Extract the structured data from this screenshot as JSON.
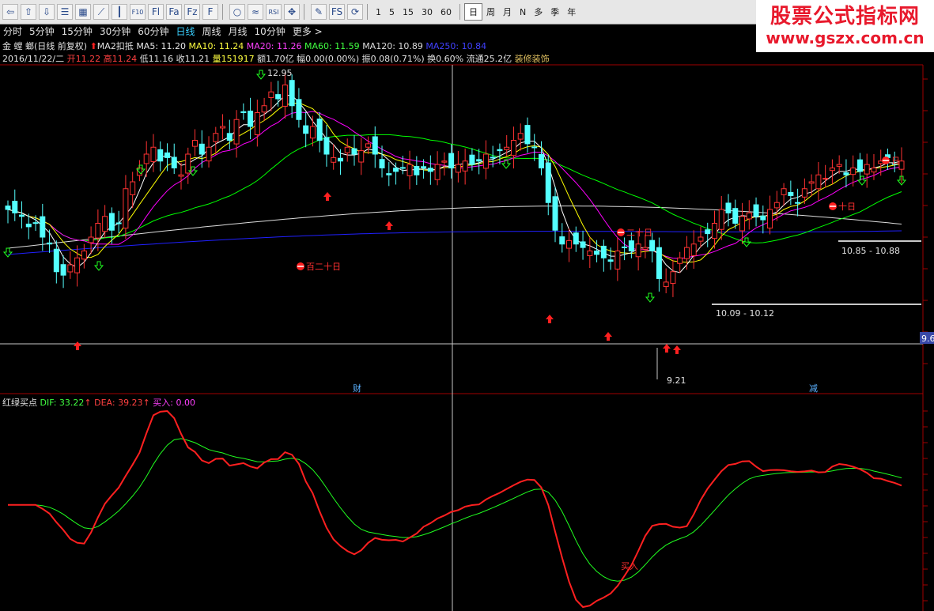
{
  "toolbar": {
    "icons": [
      "back-icon",
      "up-icon",
      "down-icon",
      "list-icon",
      "table-icon",
      "line-chart-icon",
      "candle-icon",
      "f10-icon",
      "fl-icon",
      "fa-icon",
      "fz-icon",
      "f-icon",
      "circle-icon",
      "wave-icon",
      "rsi-icon",
      "move-icon",
      "pencil-icon",
      "fs-icon",
      "refresh-icon"
    ],
    "icon_text": [
      "⇦",
      "⇧",
      "⇩",
      "☰",
      "▦",
      "⟋",
      "┃",
      "F10",
      "Fl",
      "Fa",
      "Fz",
      "F",
      "○",
      "≈",
      "RSI",
      "✥",
      "✎",
      "FS",
      "⟳"
    ],
    "intervals": [
      "1",
      "5",
      "15",
      "30",
      "60"
    ],
    "periods": [
      "日",
      "周",
      "月",
      "N",
      "多",
      "季",
      "年"
    ]
  },
  "logo": {
    "line1": "股票公式指标网",
    "line2": "www.gszx.com.cn"
  },
  "periodbar": {
    "items": [
      "分时",
      "5分钟",
      "15分钟",
      "30分钟",
      "60分钟",
      "日线",
      "周线",
      "月线",
      "10分钟",
      "更多 >"
    ],
    "active": "日线"
  },
  "info1": {
    "stock": "金 螳 螂(日线 前复权)",
    "ma2": "MA2扣抵",
    "ma5": "MA5: 11.20",
    "ma10": "MA10: 11.24",
    "ma20": "MA20: 11.26",
    "ma60": "MA60: 11.59",
    "ma120": "MA120: 10.89",
    "ma250": "MA250: 10.84"
  },
  "info2": {
    "date": "2016/11/22/二",
    "open": "开11.22",
    "high": "高11.24",
    "low": "低11.16",
    "close": "收11.21",
    "vol": "量151917",
    "amount": "额1.70亿",
    "amp": "幅0.00(0.00%)",
    "zhen": "振0.08(0.71%)",
    "turnover": "换0.60%",
    "float": "流通25.2亿",
    "industry": "装修装饰"
  },
  "labels": {
    "high": "12.95",
    "low": "9.21",
    "range1": "10.85 - 10.88",
    "range2": "10.09 - 10.12",
    "price_tag": "9.6",
    "cai": "财",
    "jian": "减",
    "bai_er_shi_ri": "百二十日",
    "er_shi_ri": "二十日",
    "shi_ri": "十日",
    "ri": "日",
    "ma_label_a": "十日",
    "buy_marker": "买入"
  },
  "sub": {
    "name": "红绿买点",
    "dif": "DIF: 33.22",
    "dea": "DEA: 39.23",
    "buy": "买入: 0.00"
  },
  "colors": {
    "up": "#ff3232",
    "down": "#54ffff",
    "ma5": "#ffffff",
    "ma10": "#ffff00",
    "ma20": "#ff00ff",
    "ma60": "#00ff00",
    "ma120": "#dcdcdc",
    "ma250": "#2020ff",
    "dif": "#ff2020",
    "dea": "#20ff20"
  },
  "chart_data": {
    "type": "candlestick",
    "closes": [
      11.1,
      11.05,
      11.0,
      10.85,
      10.9,
      10.7,
      10.6,
      10.2,
      10.15,
      10.3,
      10.4,
      10.5,
      10.7,
      10.9,
      11.0,
      10.8,
      10.9,
      11.4,
      11.5,
      11.7,
      11.9,
      12.0,
      11.8,
      11.85,
      11.7,
      11.6,
      11.9,
      12.1,
      11.9,
      12.0,
      12.2,
      12.3,
      12.1,
      12.4,
      12.5,
      12.3,
      12.5,
      12.6,
      12.8,
      12.7,
      12.9,
      12.6,
      12.4,
      12.2,
      12.3,
      12.1,
      11.9,
      11.85,
      11.8,
      12.0,
      11.9,
      11.95,
      12.05,
      11.9,
      11.7,
      11.6,
      11.65,
      11.7,
      11.75,
      11.6,
      11.7,
      11.65,
      11.75,
      11.8,
      11.7,
      11.75,
      11.8,
      11.75,
      11.8,
      11.9,
      11.85,
      11.95,
      12.0,
      12.1,
      12.2,
      12.05,
      12.0,
      11.7,
      11.2,
      10.8,
      10.6,
      10.65,
      10.6,
      10.55,
      10.5,
      10.45,
      10.4,
      10.35,
      10.5,
      10.55,
      10.5,
      10.6,
      10.55,
      10.5,
      10.1,
      10.05,
      10.2,
      10.4,
      10.55,
      10.6,
      10.7,
      10.75,
      10.9,
      11.1,
      11.05,
      10.9,
      11.0,
      11.05,
      11.0,
      10.95,
      11.1,
      11.2,
      11.4,
      11.3,
      11.2,
      11.4,
      11.5,
      11.6,
      11.55,
      11.7,
      11.75,
      11.6,
      11.7,
      11.65,
      11.75,
      11.7,
      11.8,
      11.85,
      11.75,
      11.8
    ]
  }
}
